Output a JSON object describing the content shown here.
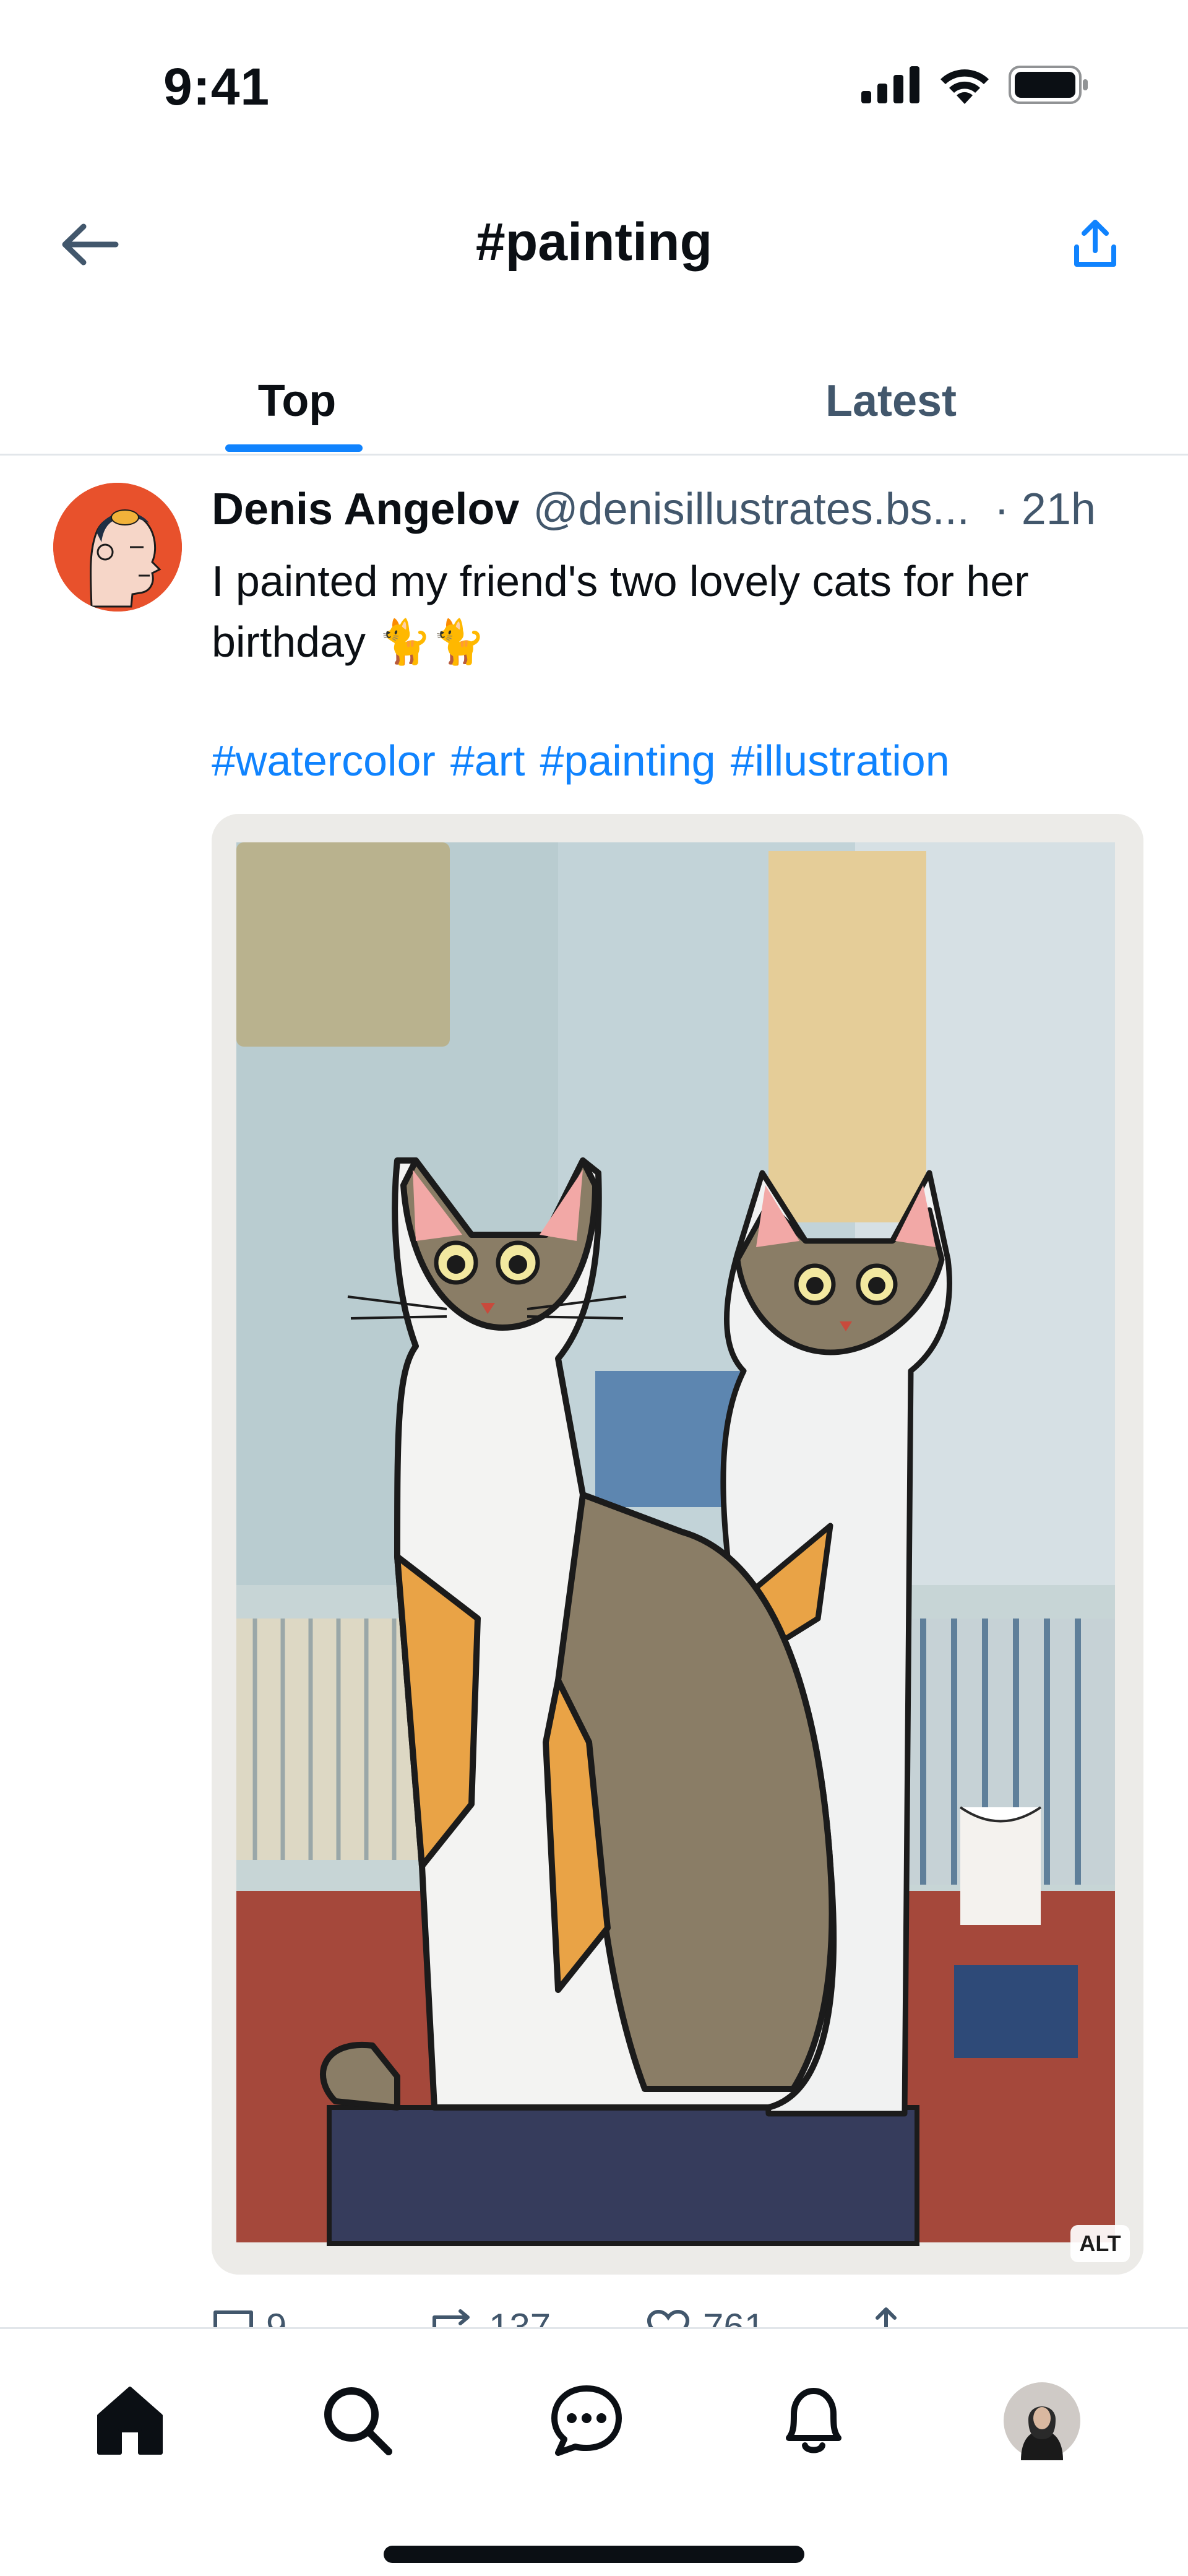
{
  "status_bar": {
    "time": "9:41",
    "icons": [
      "cellular-signal-icon",
      "wifi-icon",
      "battery-icon"
    ]
  },
  "header": {
    "title": "#painting",
    "back_icon": "arrow-left-icon",
    "share_icon": "share-upload-icon"
  },
  "tabs": [
    {
      "label": "Top",
      "active": true
    },
    {
      "label": "Latest",
      "active": false
    }
  ],
  "post": {
    "author_name": "Denis Angelov",
    "author_handle": "@denisillustrates.bs...",
    "time": "· 21h",
    "text": "I painted my friend's two lovely cats for her birthday 🐈🐈",
    "hashtags": [
      "#watercolor",
      "#art",
      "#painting",
      "#illustration"
    ],
    "image_alt_badge": "ALT",
    "actions": {
      "replies": "9",
      "reposts": "137",
      "likes": "761"
    }
  },
  "bottom_nav": {
    "items": [
      "home-icon",
      "search-icon",
      "chat-icon",
      "bell-icon",
      "profile-avatar"
    ]
  },
  "colors": {
    "accent": "#1083fe",
    "secondary_text": "#42576c",
    "primary_text": "#0b0f14",
    "divider": "#e2e6ea"
  }
}
